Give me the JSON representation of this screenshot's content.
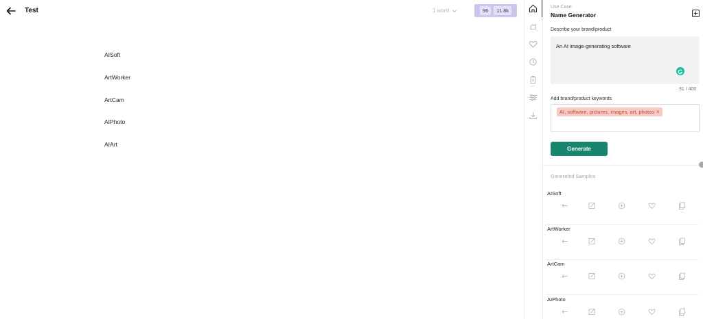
{
  "header": {
    "title": "Test",
    "word_count": "1 word",
    "score_a": "96",
    "score_b": "11.8k"
  },
  "document": {
    "lines": [
      "AISoft",
      "ArtWorker",
      "ArtCam",
      "AIPhoto",
      "AIArt"
    ]
  },
  "rail": {
    "icons": [
      "home-icon",
      "brand-voice-icon",
      "heart-icon",
      "history-icon",
      "clipboard-icon",
      "settings-sliders-icon",
      "download-icon"
    ]
  },
  "panel": {
    "use_case_label": "Use Case",
    "use_case_title": "Name Generator",
    "describe_label": "Describe your brand/product",
    "describe_value": "An AI image-generating software",
    "char_count": "31 / 400",
    "keywords_label": "Add brand/product keywords",
    "keywords_chip": "AI, software, pictures, images, art, photos",
    "generate_label": "Generate",
    "samples_label": "Generated Samples",
    "samples": [
      "AISoft",
      "ArtWorker",
      "ArtCam",
      "AIPhoto"
    ]
  },
  "colors": {
    "accent": "#18866f",
    "chip_bg": "#f5cbc3",
    "chip_text": "#c14a36",
    "score_bg": "#c9c7ee",
    "grammarly": "#15c39a"
  }
}
